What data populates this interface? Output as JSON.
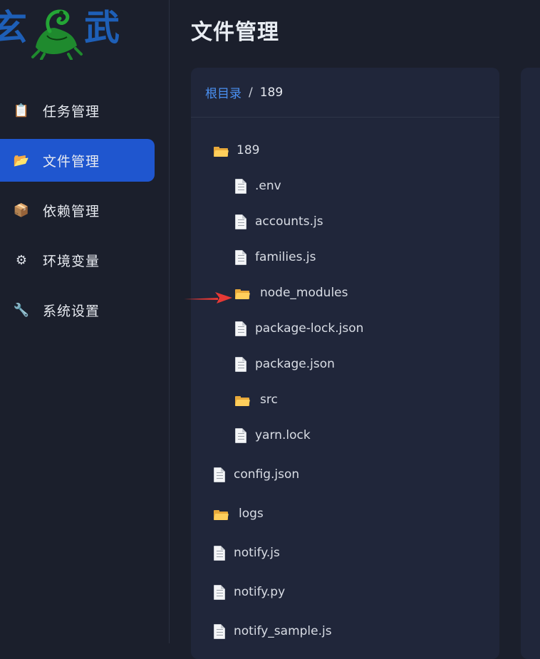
{
  "logo": {
    "chars": [
      "玄",
      "武"
    ]
  },
  "sidebar": {
    "items": [
      {
        "label": "任务管理",
        "icon": "clipboard-icon",
        "glyph": "📋",
        "active": false
      },
      {
        "label": "文件管理",
        "icon": "folder-icon",
        "glyph": "📂",
        "active": true
      },
      {
        "label": "依赖管理",
        "icon": "package-box-icon",
        "glyph": "📦",
        "active": false
      },
      {
        "label": "环境变量",
        "icon": "gear-icon",
        "glyph": "⚙",
        "active": false
      },
      {
        "label": "系统设置",
        "icon": "wrench-icon",
        "glyph": "🔧",
        "active": false
      }
    ]
  },
  "header": {
    "title": "文件管理"
  },
  "breadcrumb": {
    "root": "根目录",
    "separator": "/",
    "current": "189"
  },
  "tree": {
    "root_folder": "189",
    "children": [
      {
        "name": ".env",
        "type": "file"
      },
      {
        "name": "accounts.js",
        "type": "file"
      },
      {
        "name": "families.js",
        "type": "file"
      },
      {
        "name": "node_modules",
        "type": "folder"
      },
      {
        "name": "package-lock.json",
        "type": "file"
      },
      {
        "name": "package.json",
        "type": "file"
      },
      {
        "name": "src",
        "type": "folder"
      },
      {
        "name": "yarn.lock",
        "type": "file"
      }
    ],
    "top_level": [
      {
        "name": "config.json",
        "type": "file"
      },
      {
        "name": "logs",
        "type": "folder"
      },
      {
        "name": "notify.js",
        "type": "file"
      },
      {
        "name": "notify.py",
        "type": "file"
      },
      {
        "name": "notify_sample.js",
        "type": "file"
      }
    ]
  },
  "colors": {
    "accent": "#1f56cf",
    "link": "#4a90f2",
    "background": "#1b1f2c",
    "panel": "#20263a",
    "annotation_arrow": "#e53935"
  }
}
